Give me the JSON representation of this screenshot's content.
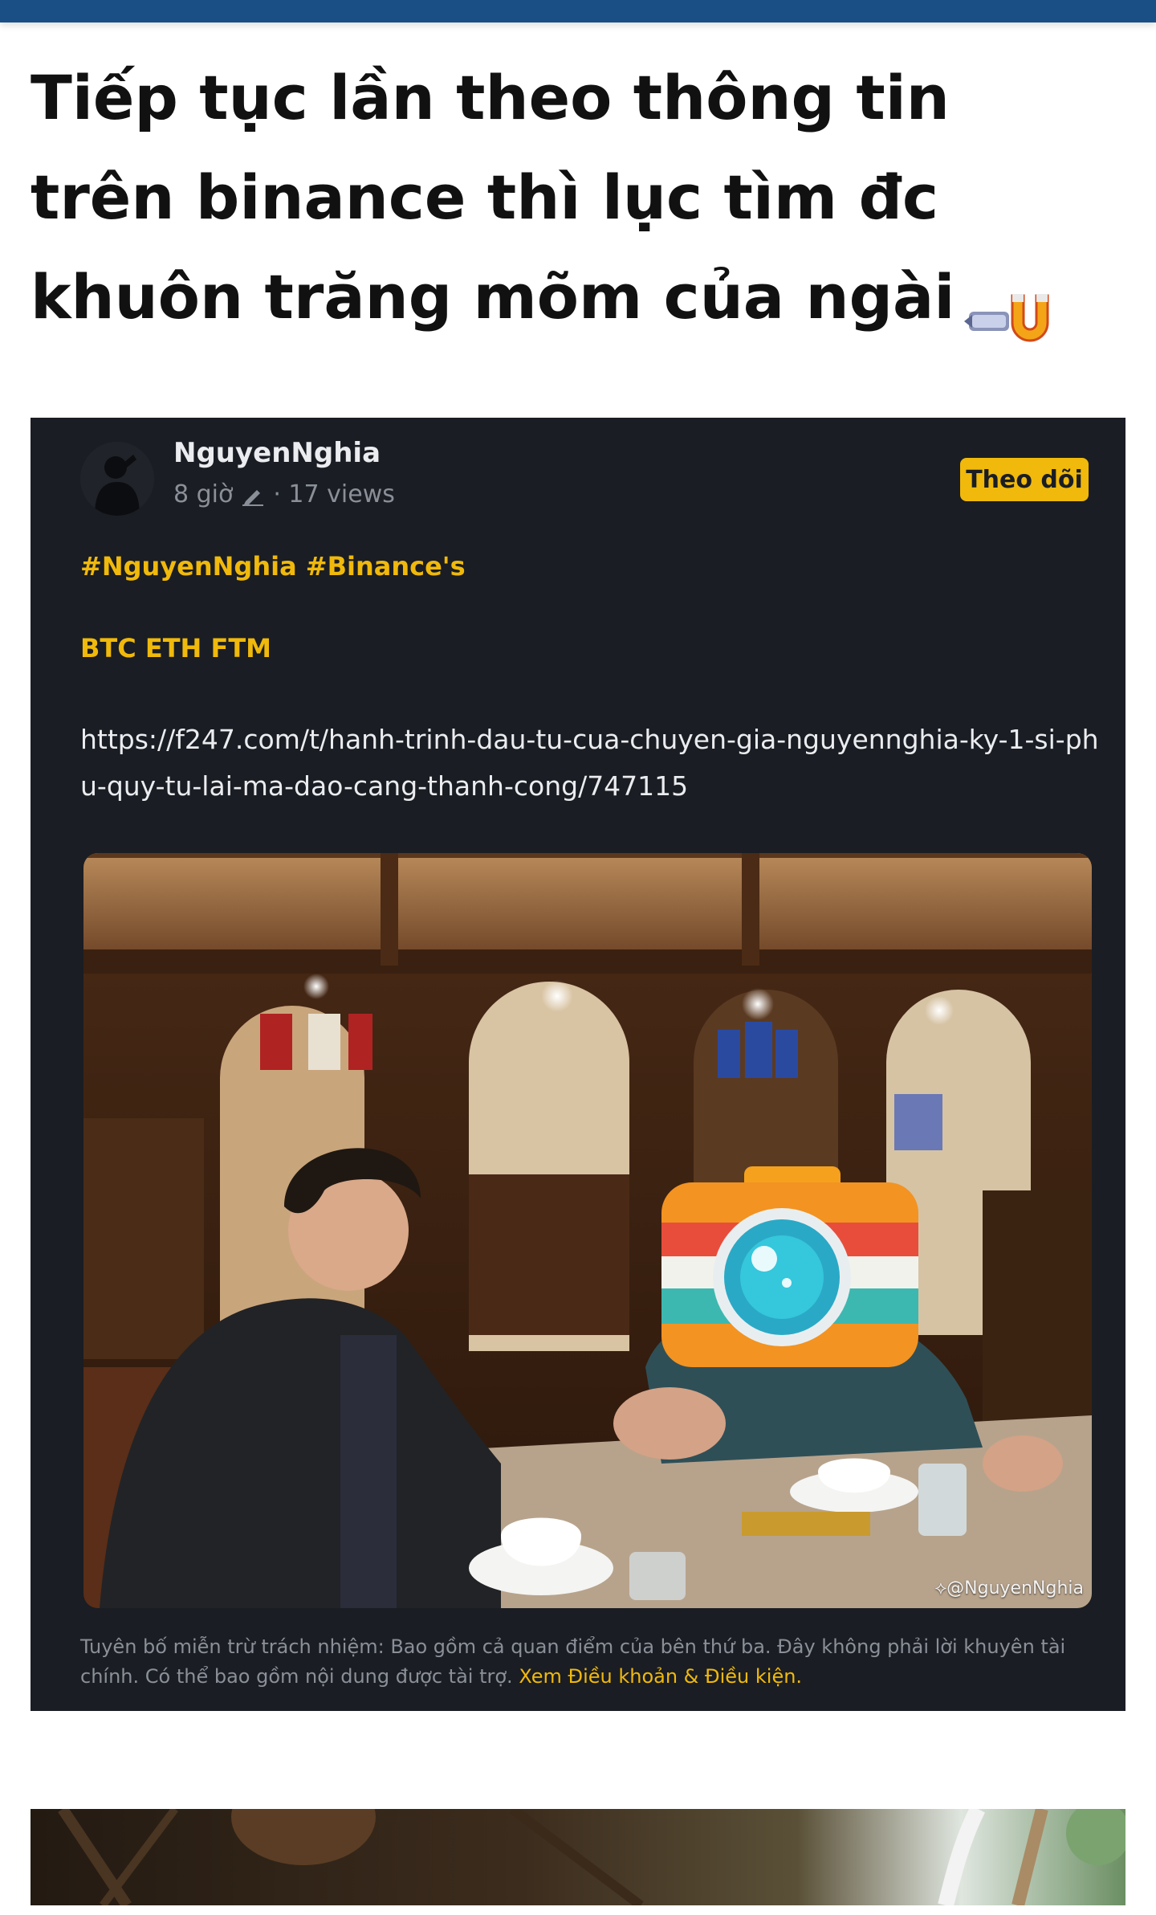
{
  "post": {
    "title": "Tiếp tục lần theo thông tin trên binance thì lục tìm đc khuôn trăng mõm của ngài"
  },
  "embed": {
    "author": "NguyenNghia",
    "time": "8 giờ",
    "views": "· 17 views",
    "follow_label": "Theo dõi",
    "hashtags": "#NguyenNghia #Binance's",
    "coins": "BTC ETH FTM",
    "link": "https://f247.com/t/hanh-trinh-dau-tu-cua-chuyen-gia-nguyennghia-ky-1-si-phu-quy-tu-lai-ma-dao-cang-thanh-cong/747115",
    "watermark": "@NguyenNghia",
    "disclaimer": "Tuyên bố miễn trừ trách nhiệm: Bao gồm cả quan điểm của bên thứ ba. Đây không phải lời khuyên tài chính. Có thể bao gồm nội dung được tài trợ.",
    "terms_link": "Xem Điều khoản & Điều kiện."
  },
  "colors": {
    "top_bar": "#1a4f86",
    "card_bg": "#1a1d23",
    "accent": "#f0b90b",
    "text_primary": "#eaecef",
    "text_muted": "#8a8f98"
  },
  "icons": {
    "title_emoji": "magnet-pulling-emoji",
    "edit": "edit-pen-icon",
    "camera": "camera-sticker-icon",
    "watermark": "binance-logo-icon"
  }
}
